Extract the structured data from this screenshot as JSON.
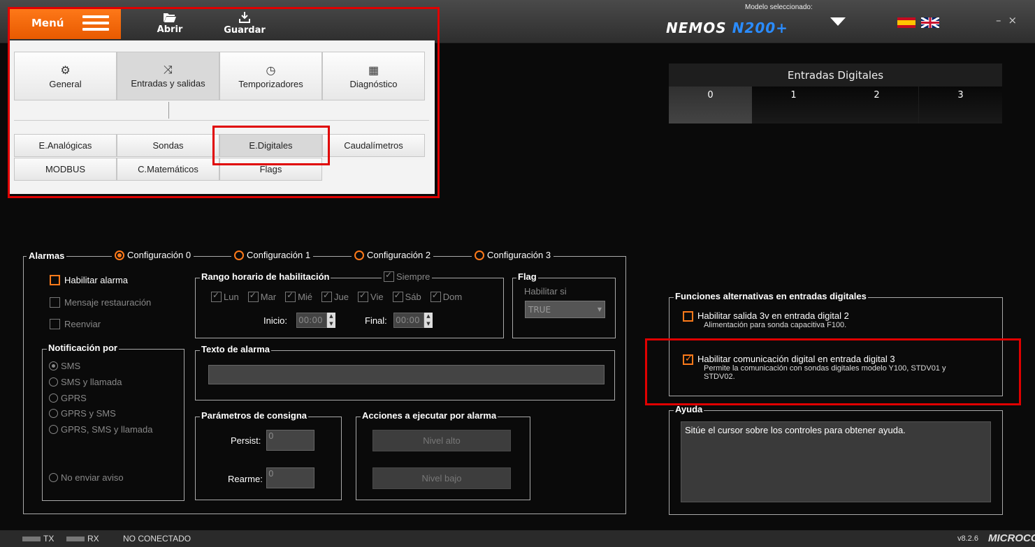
{
  "toolbar": {
    "menu_label": "Menú",
    "open_label": "Abrir",
    "save_label": "Guardar",
    "model_label": "Modelo seleccionado:",
    "logo_a": "NEMOS",
    "logo_b": "N200+",
    "minimize": "–",
    "close": "×"
  },
  "menu": {
    "tabs": [
      {
        "label": "General",
        "icon": "gear-icon"
      },
      {
        "label": "Entradas y salidas",
        "icon": "shuffle-icon"
      },
      {
        "label": "Temporizadores",
        "icon": "timer-icon"
      },
      {
        "label": "Diagnóstico",
        "icon": "chip-icon"
      }
    ],
    "subs": [
      "E.Analógicas",
      "Sondas",
      "E.Digitales",
      "Caudalímetros",
      "MODBUS",
      "C.Matemáticos",
      "Flags"
    ]
  },
  "digital_inputs": {
    "title": "Entradas Digitales",
    "cells": [
      "0",
      "1",
      "2",
      "3"
    ]
  },
  "alarms": {
    "legend": "Alarmas",
    "configs": [
      "Configuración 0",
      "Configuración 1",
      "Configuración 2",
      "Configuración 3"
    ],
    "enable_alarm": "Habilitar alarma",
    "restore_msg": "Mensaje restauración",
    "resend": "Reenviar",
    "schedule_legend": "Rango horario de habilitación",
    "always": "Siempre",
    "days": [
      "Lun",
      "Mar",
      "Mié",
      "Jue",
      "Vie",
      "Sáb",
      "Dom"
    ],
    "start_label": "Inicio:",
    "start_value": "00:00",
    "end_label": "Final:",
    "end_value": "00:00",
    "flag_legend": "Flag",
    "flag_enable_if": "Habilitar si",
    "flag_value": "TRUE",
    "notify_legend": "Notificación por",
    "notify_options": [
      "SMS",
      "SMS y llamada",
      "GPRS",
      "GPRS y SMS",
      "GPRS, SMS y llamada"
    ],
    "no_notify": "No enviar aviso",
    "text_legend": "Texto de alarma",
    "setpoint_legend": "Parámetros de consigna",
    "persist_label": "Persist:",
    "persist_value": "0",
    "rearm_label": "Rearme:",
    "rearm_value": "0",
    "actions_legend": "Acciones a ejecutar por alarma",
    "high_level": "Nivel alto",
    "low_level": "Nivel bajo"
  },
  "alt_functions": {
    "legend": "Funciones alternativas en entradas digitales",
    "opt1_title": "Habilitar salida 3v en entrada digital 2",
    "opt1_desc": "Alimentación para sonda capacitiva F100.",
    "opt2_title": "Habilitar comunicación digital en entrada digital 3",
    "opt2_desc1": "Permite la comunicación con sondas digitales modelo Y100, STDV01 y",
    "opt2_desc2": "STDV02."
  },
  "help": {
    "legend": "Ayuda",
    "text": "Sitúe el cursor sobre los controles para obtener ayuda."
  },
  "status": {
    "tx": "TX",
    "rx": "RX",
    "connection": "NO CONECTADO",
    "version": "v8.2.6",
    "brand": "MICROCOM"
  }
}
